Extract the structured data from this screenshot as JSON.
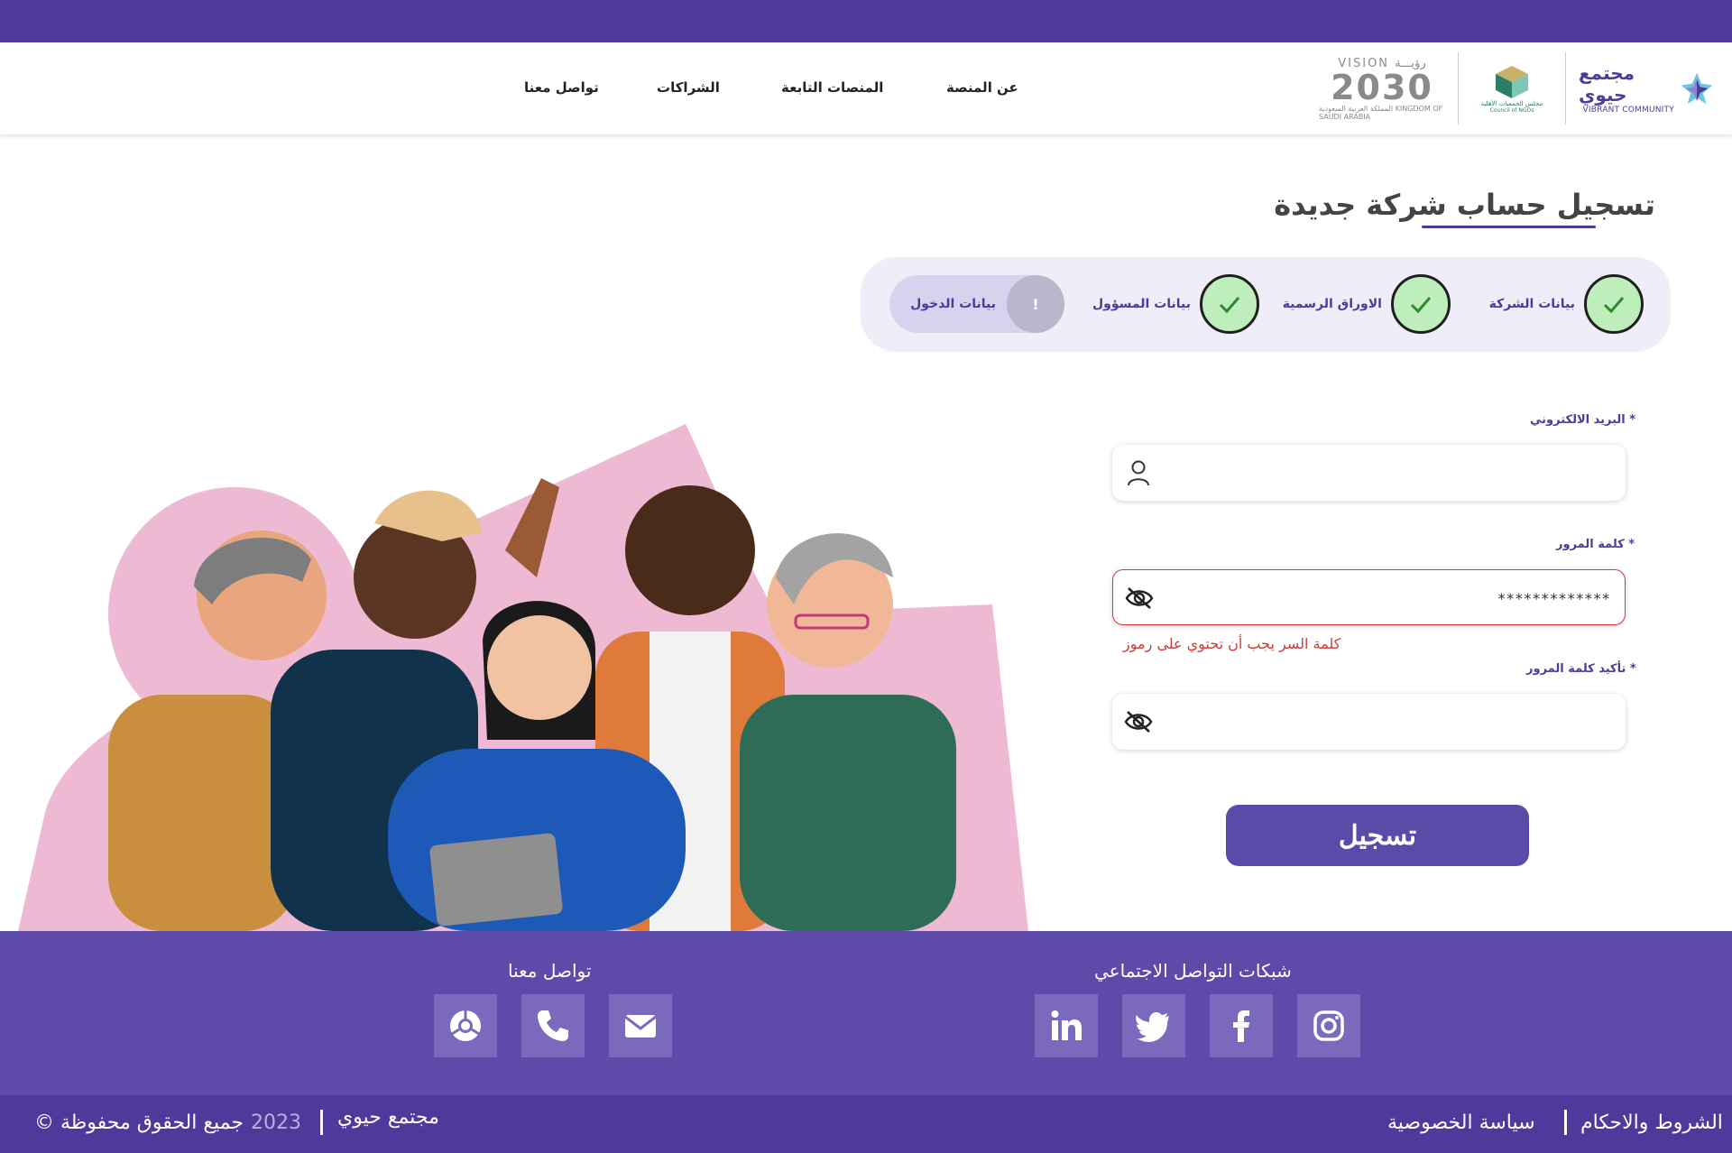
{
  "header": {
    "logos": {
      "vibrant_ar": "مجتمع حيوي",
      "vibrant_en": "VIBRANT COMMUNITY",
      "ngo_ar": "مجلس الجمعيات الأهلية",
      "ngo_en": "Council of NGOs",
      "vision_top": "VISION رؤيـــة",
      "vision_year": "2030",
      "vision_bottom": "المملكة العربية السعودية KINGDOM OF SAUDI ARABIA"
    },
    "nav": [
      "عن المنصة",
      "المنصات التابعة",
      "الشراكات",
      "تواصل معنا"
    ]
  },
  "page_title": "تسجيل حساب شركة جديدة",
  "steps": [
    {
      "label": "بيانات الشركة",
      "state": "done"
    },
    {
      "label": "الاوراق الرسمية",
      "state": "done"
    },
    {
      "label": "بيانات المسؤول",
      "state": "done"
    },
    {
      "label": "بيانات الدخول",
      "state": "current",
      "badge": "!"
    }
  ],
  "form": {
    "email": {
      "label": "البريد الالكتروني *",
      "value": "",
      "icon": "user-icon"
    },
    "password": {
      "label": "كلمة المرور *",
      "value": "*************",
      "icon": "eye-slash-icon",
      "error": "كلمة السر يجب أن تحتوي على رموز"
    },
    "confirm": {
      "label": "تأكيد كلمة المرور *",
      "value": "",
      "icon": "eye-slash-icon"
    },
    "submit": "تسجيل"
  },
  "footer": {
    "social_title": "شبكات التواصل الاجتماعي",
    "social_icons": [
      "instagram-icon",
      "facebook-icon",
      "twitter-icon",
      "linkedin-icon"
    ],
    "contact_title": "تواصل معنا",
    "contact_icons": [
      "email-icon",
      "phone-icon",
      "chrome-icon"
    ]
  },
  "bottom": {
    "terms": "الشروط والاحكام",
    "privacy": "سياسة الخصوصية",
    "brand": "مجتمع حيوي",
    "year": "2023",
    "rights": "© جميع الحقوق محفوظة"
  },
  "colors": {
    "primary": "#4e3a9b",
    "footer": "#5d4aa9",
    "error": "#d13b3b",
    "step_done": "#bdeebb"
  }
}
